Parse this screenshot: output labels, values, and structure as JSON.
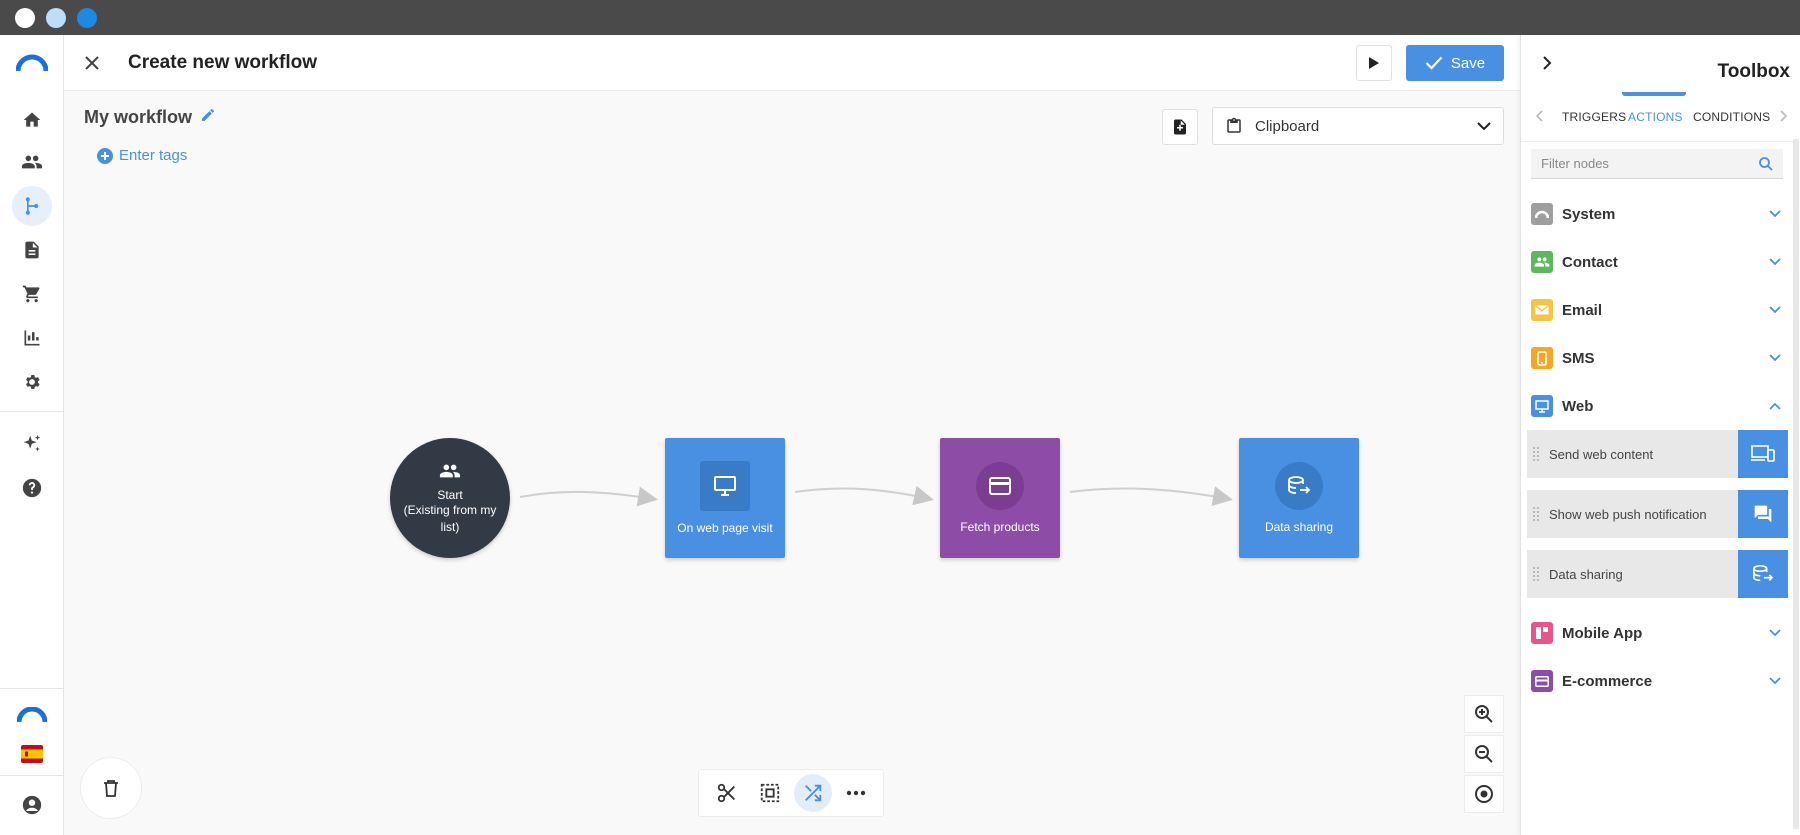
{
  "colors": {
    "accent": "#4a90e2",
    "start_node": "#323a45",
    "fetch_node": "#8d4ca5",
    "web_node": "#4a90e2",
    "system": "#9e9e9e",
    "contact": "#5cb85c",
    "email": "#f4c542",
    "sms": "#f5a623",
    "web": "#4a90e2",
    "mobile_app": "#e8558c",
    "ecommerce": "#8d4ca5"
  },
  "window": {
    "dots": [
      "#ffffff",
      "#bbdefb",
      "#1e88e5"
    ]
  },
  "nav": {
    "items": [
      {
        "name": "home-icon"
      },
      {
        "name": "contacts-icon"
      },
      {
        "name": "workflow-icon",
        "active": true
      },
      {
        "name": "document-icon"
      },
      {
        "name": "cart-icon"
      },
      {
        "name": "chart-icon"
      },
      {
        "name": "settings-icon"
      },
      {
        "name": "sparkle-icon"
      },
      {
        "name": "help-icon"
      }
    ],
    "language": "ES"
  },
  "header": {
    "title": "Create new workflow",
    "save_label": "Save"
  },
  "canvas": {
    "workflow_name": "My workflow",
    "tags_label": "Enter tags",
    "clipboard_label": "Clipboard",
    "nodes": [
      {
        "id": "start",
        "label_line1": "Start",
        "label_line2": "(Existing from my list)",
        "icon": "contacts-icon"
      },
      {
        "id": "web-visit",
        "label": "On web page visit",
        "icon": "monitor-icon"
      },
      {
        "id": "fetch",
        "label": "Fetch products",
        "icon": "card-icon"
      },
      {
        "id": "data-sharing",
        "label": "Data sharing",
        "icon": "database-share-icon"
      }
    ]
  },
  "toolbox": {
    "title": "Toolbox",
    "tabs": [
      "TRIGGERS",
      "ACTIONS",
      "CONDITIONS"
    ],
    "active_tab": "ACTIONS",
    "filter_placeholder": "Filter nodes",
    "categories": [
      {
        "label": "System",
        "icon": "cloud-icon",
        "expanded": false
      },
      {
        "label": "Contact",
        "icon": "contacts-icon",
        "expanded": false
      },
      {
        "label": "Email",
        "icon": "envelope-icon",
        "expanded": false
      },
      {
        "label": "SMS",
        "icon": "phone-icon",
        "expanded": false
      },
      {
        "label": "Web",
        "icon": "monitor-icon",
        "expanded": true
      },
      {
        "label": "Mobile App",
        "icon": "mobile-app-icon",
        "expanded": false
      },
      {
        "label": "E-commerce",
        "icon": "card-icon",
        "expanded": false
      }
    ],
    "web_items": [
      {
        "label": "Send web content",
        "icon": "devices-icon"
      },
      {
        "label": "Show web push notification",
        "icon": "chat-icon"
      },
      {
        "label": "Data sharing",
        "icon": "database-share-icon"
      }
    ]
  }
}
